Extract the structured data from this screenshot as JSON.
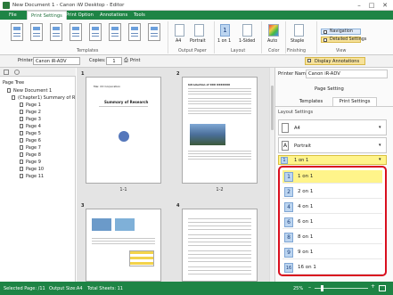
{
  "window": {
    "title": "New Document 1 - Canon iW Desktop - Editor"
  },
  "menu": {
    "items": [
      "File",
      "Print Settings",
      "Print Option",
      "Annotations",
      "Tools"
    ],
    "active": 1
  },
  "ribbon": {
    "groups": {
      "templates": "Templates",
      "output_paper": "Output Paper",
      "layout": "Layout",
      "color": "Color",
      "finishing": "Finishing",
      "view": "View"
    },
    "paper_size": "A4",
    "orientation": "Portrait",
    "layout_value": "1 on 1",
    "sided": "1-Sided",
    "color_value": "Auto",
    "staple": "Staple",
    "view_navigation": "Navigation",
    "view_detailed": "Detailed Settings"
  },
  "toolbar": {
    "printer_label": "Printer:",
    "printer_value": "Canon iR-ADV",
    "copies_label": "Copies:",
    "copies_value": "1",
    "print_label": "Print",
    "display_annotations": "Display Annotations"
  },
  "left_panel": {
    "title": "Page Tree",
    "document": "New Document 1",
    "chapter": "(Chapter1) Summary of R",
    "pages": [
      "Page 1",
      "Page 2",
      "Page 3",
      "Page 4",
      "Page 5",
      "Page 6",
      "Page 7",
      "Page 8",
      "Page 9",
      "Page 10",
      "Page 11"
    ]
  },
  "center": {
    "pages": [
      {
        "num": "1",
        "label": "1-1",
        "heading": "Summary of Research",
        "co": "Mar. XX Corporation"
      },
      {
        "num": "2",
        "label": "1-2",
        "heading": "Introduction of XXX XXXXXXX"
      },
      {
        "num": "3",
        "label": ""
      },
      {
        "num": "4",
        "label": ""
      }
    ]
  },
  "right_panel": {
    "printer_label": "Printer Name:",
    "printer_value": "Canon iR-ADV",
    "page_setting": "Page Setting",
    "tabs": [
      "Templates",
      "Print Settings"
    ],
    "active_tab": 1,
    "section": "Layout Settings",
    "paper": "A4",
    "orientation": "Portrait",
    "layout_selected": "1 on 1",
    "layout_options": [
      {
        "icon": "1",
        "label": "1 on 1"
      },
      {
        "icon": "2",
        "label": "2 on 1"
      },
      {
        "icon": "4",
        "label": "4 on 1"
      },
      {
        "icon": "6",
        "label": "6 on 1"
      },
      {
        "icon": "8",
        "label": "8 on 1"
      },
      {
        "icon": "9",
        "label": "9 on 1"
      },
      {
        "icon": "16",
        "label": "16 on 1"
      }
    ],
    "layout_options_selected": 0
  },
  "status": {
    "selected_page": "Selected Page: /11",
    "output_size": "Output Size:A4",
    "total_sheets": "Total Sheets: 11",
    "zoom": "25%"
  },
  "colors": {
    "brand_green": "#1e8445",
    "dropdown_highlight": "#fff48a",
    "dropdown_border": "#d90f1f"
  }
}
